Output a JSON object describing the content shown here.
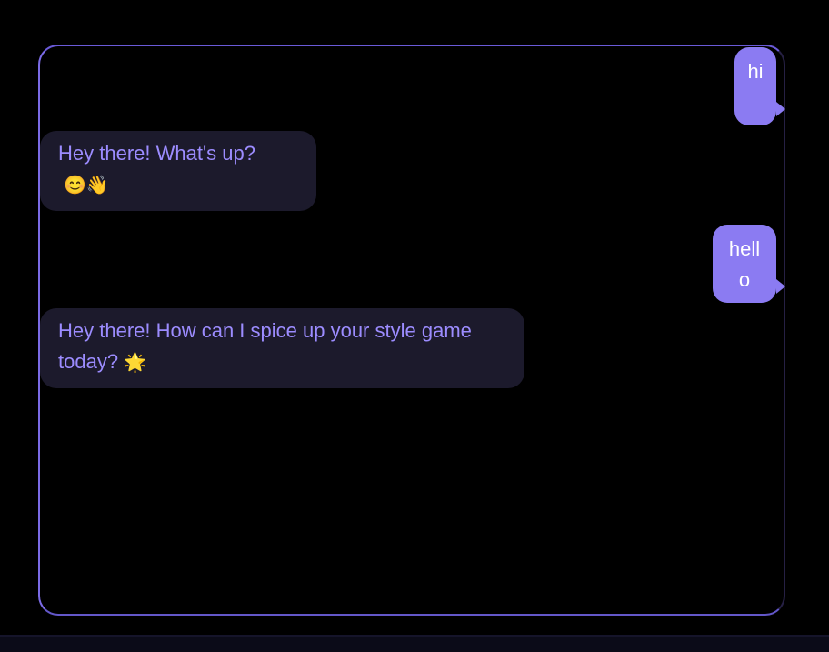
{
  "messages": [
    {
      "role": "user",
      "text": "hi"
    },
    {
      "role": "assistant",
      "text": "Hey there! What's up?",
      "emojis": "😊👋"
    },
    {
      "role": "user",
      "text": "hello"
    },
    {
      "role": "assistant",
      "text": "Hey there! How can I spice up your style game today?",
      "emojis": "🌟"
    }
  ],
  "colors": {
    "accent": "#8b7bf2",
    "bot_text": "#9c8cff",
    "bot_bubble": "#1c1a2c",
    "background": "#000000"
  }
}
